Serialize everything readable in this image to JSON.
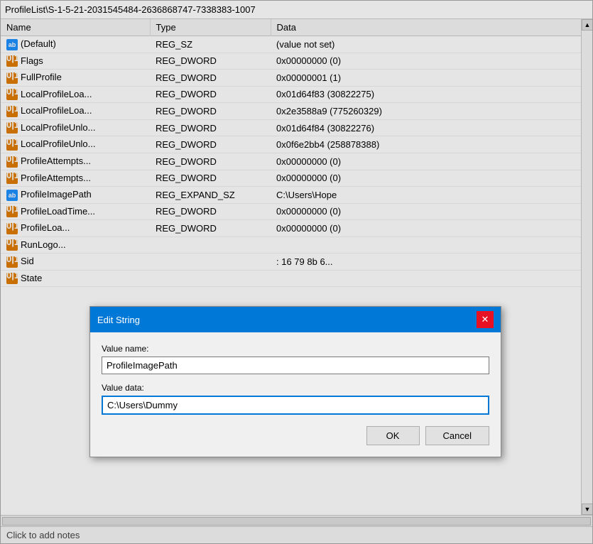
{
  "window": {
    "breadcrumb": "ProfileList\\S-1-5-21-2031545484-2636868747-7338383-1007"
  },
  "table": {
    "columns": [
      "Name",
      "Type",
      "Data"
    ],
    "rows": [
      {
        "icon": "ab",
        "name": "(Default)",
        "type": "REG_SZ",
        "data": "(value not set)"
      },
      {
        "icon": "dword",
        "name": "Flags",
        "type": "REG_DWORD",
        "data": "0x00000000 (0)"
      },
      {
        "icon": "dword",
        "name": "FullProfile",
        "type": "REG_DWORD",
        "data": "0x00000001 (1)"
      },
      {
        "icon": "dword",
        "name": "LocalProfileLoa...",
        "type": "REG_DWORD",
        "data": "0x01d64f83 (30822275)"
      },
      {
        "icon": "dword",
        "name": "LocalProfileLoa...",
        "type": "REG_DWORD",
        "data": "0x2e3588a9 (775260329)"
      },
      {
        "icon": "dword",
        "name": "LocalProfileUnlo...",
        "type": "REG_DWORD",
        "data": "0x01d64f84 (30822276)"
      },
      {
        "icon": "dword",
        "name": "LocalProfileUnlo...",
        "type": "REG_DWORD",
        "data": "0x0f6e2bb4 (258878388)"
      },
      {
        "icon": "dword",
        "name": "ProfileAttempts...",
        "type": "REG_DWORD",
        "data": "0x00000000 (0)"
      },
      {
        "icon": "dword",
        "name": "ProfileAttempts...",
        "type": "REG_DWORD",
        "data": "0x00000000 (0)"
      },
      {
        "icon": "ab",
        "name": "ProfileImagePath",
        "type": "REG_EXPAND_SZ",
        "data": "C:\\Users\\Hope"
      },
      {
        "icon": "dword",
        "name": "ProfileLoadTime...",
        "type": "REG_DWORD",
        "data": "0x00000000 (0)"
      },
      {
        "icon": "dword",
        "name": "ProfileLoa...",
        "type": "REG_DWORD",
        "data": "0x00000000 (0)",
        "partial": true
      },
      {
        "icon": "dword",
        "name": "RunLogo...",
        "type": "",
        "data": ""
      },
      {
        "icon": "dword",
        "name": "Sid",
        "type": "",
        "data": ": 16 79 8b 6..."
      },
      {
        "icon": "dword",
        "name": "State",
        "type": "",
        "data": ""
      }
    ]
  },
  "dialog": {
    "title": "Edit String",
    "close_label": "✕",
    "value_name_label": "Value name:",
    "value_name_value": "ProfileImagePath",
    "value_data_label": "Value data:",
    "value_data_value": "C:\\Users\\Dummy",
    "ok_label": "OK",
    "cancel_label": "Cancel"
  },
  "status_bar": {
    "text": "Click to add notes"
  },
  "icons": {
    "ab_text": "ab",
    "dword_text": "0|1"
  }
}
